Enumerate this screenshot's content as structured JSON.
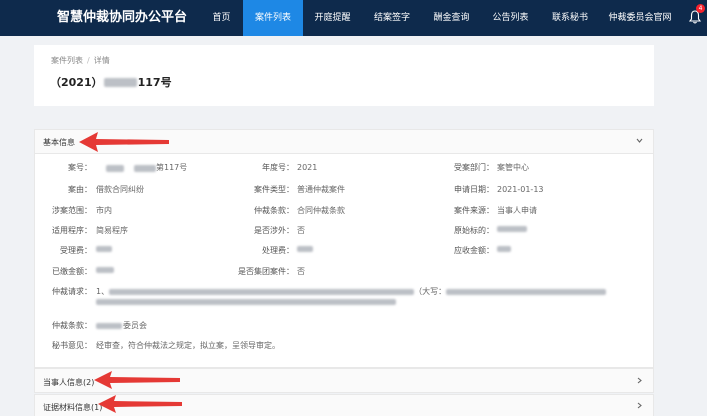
{
  "header": {
    "brand": "智慧仲裁协同办公平台",
    "nav": [
      {
        "label": "首页",
        "active": false
      },
      {
        "label": "案件列表",
        "active": true
      },
      {
        "label": "开庭提醒",
        "active": false
      },
      {
        "label": "结案签字",
        "active": false
      },
      {
        "label": "酬金查询",
        "active": false
      },
      {
        "label": "公告列表",
        "active": false
      },
      {
        "label": "联系秘书",
        "active": false
      },
      {
        "label": "仲裁委员会官网",
        "active": false
      }
    ],
    "notification_count": "4"
  },
  "breadcrumb": {
    "parent": "案件列表",
    "separator": "/",
    "current": "详情"
  },
  "page_title": {
    "prefix": "（2021）",
    "suffix": "117号"
  },
  "basic_info": {
    "title": "基本信息",
    "labels": {
      "case_no": "案号：",
      "year_no": "年度号：",
      "dept": "受案部门：",
      "cause": "案由：",
      "case_type": "案件类型：",
      "apply_date": "申请日期：",
      "scope": "涉案范围：",
      "clause": "仲裁条款：",
      "source": "案件来源：",
      "procedure": "适用程序：",
      "foreign": "是否涉外：",
      "original_amount": "原始标的：",
      "accept_fee": "受理费：",
      "handle_fee": "处理费：",
      "receivable": "应收金额：",
      "paid": "已缴金额：",
      "group_case": "是否集团案件：",
      "request": "仲裁请求：",
      "clause2": "仲裁条款：",
      "secretary": "秘书意见："
    },
    "values": {
      "case_no_suffix": "第117号",
      "year_no": "2021",
      "dept": "案管中心",
      "cause": "借款合同纠纷",
      "case_type": "普通仲裁案件",
      "apply_date": "2021-01-13",
      "scope": "市内",
      "clause": "合同仲裁条款",
      "source": "当事人申请",
      "procedure": "简易程序",
      "foreign": "否",
      "group_case": "否",
      "request_start": "1、",
      "request_mid": "（大写：",
      "clause2_suffix": "委员会",
      "secretary": "经审查，符合仲裁法之规定，拟立案，呈领导审定。"
    }
  },
  "party_info": {
    "title": "当事人信息(2)"
  },
  "evidence_info": {
    "title": "证据材料信息(1)"
  },
  "colors": {
    "header_bg": "#0e2a4c",
    "nav_active": "#1e88e5",
    "arrow": "#e53935",
    "badge": "#f5222d"
  },
  "icons": {
    "bell": "bell-icon",
    "chevron_down": "chevron-down-icon",
    "chevron_right": "chevron-right-icon",
    "arrow": "arrow-left-icon"
  }
}
